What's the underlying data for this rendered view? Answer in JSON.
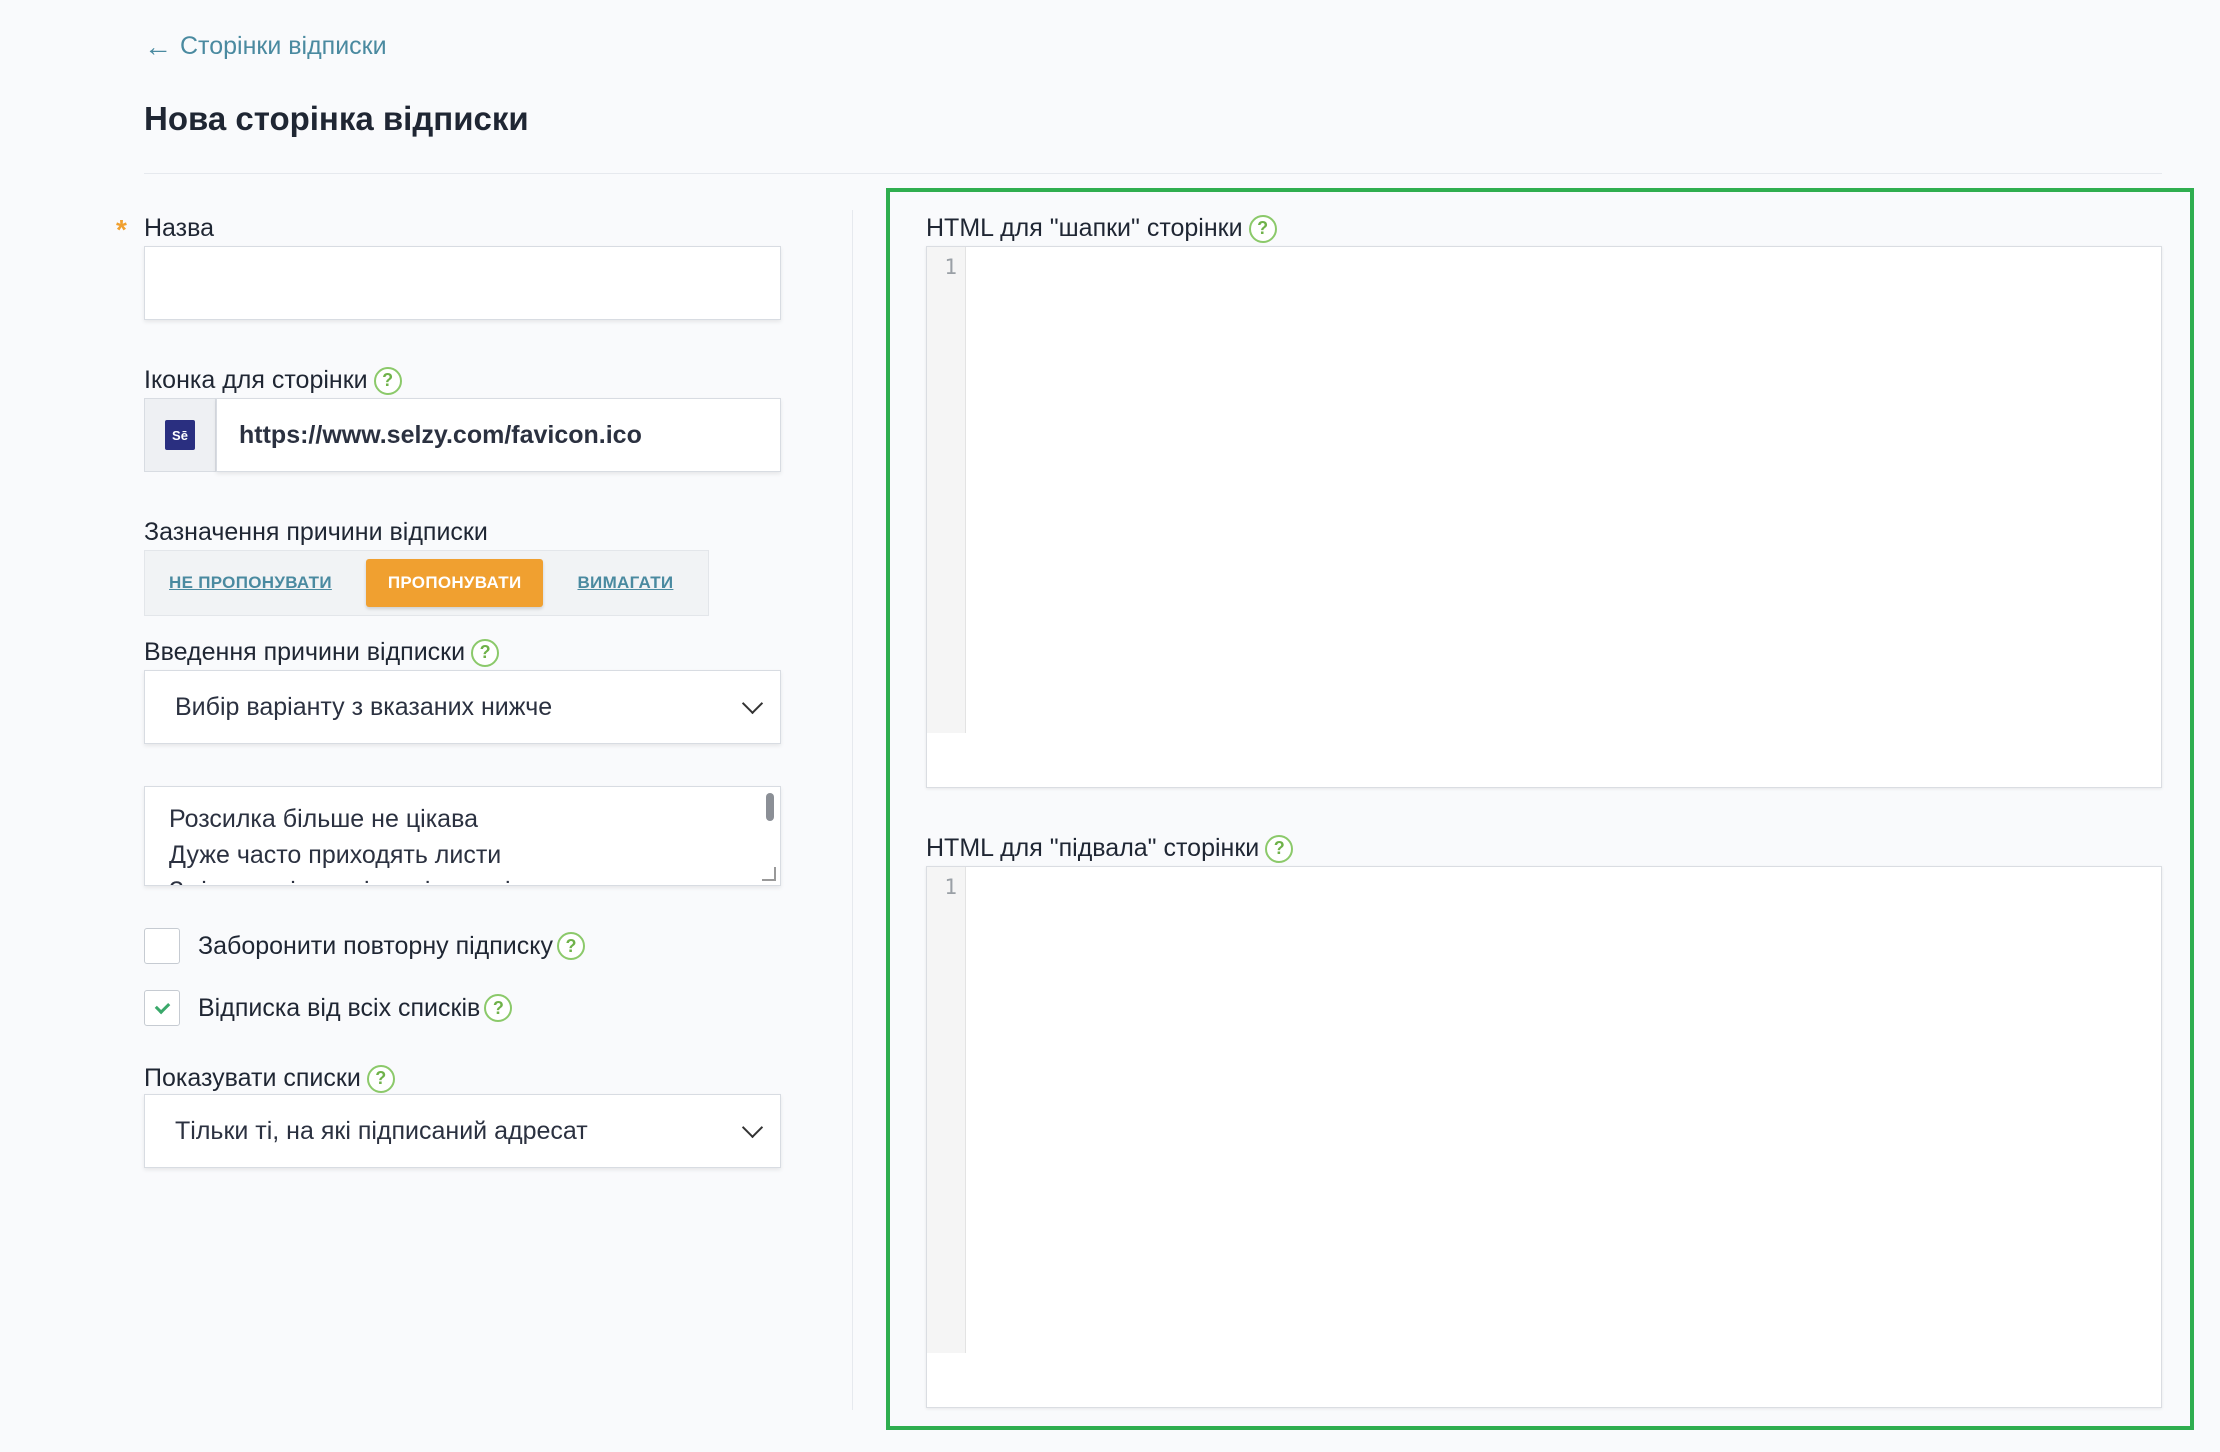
{
  "nav": {
    "back_arrow": "←",
    "back_label": "Сторінки відписки"
  },
  "page": {
    "title": "Нова сторінка відписки"
  },
  "form": {
    "name_label": "Назва",
    "required_mark": "*",
    "name_value": "",
    "icon_label": "Іконка для сторінки",
    "icon_text": "Sē",
    "icon_url": "https://www.selzy.com/favicon.ico",
    "reason_label": "Зазначення причини відписки",
    "reason_options": [
      "НЕ ПРОПОНУВАТИ",
      "ПРОПОНУВАТИ",
      "ВИМАГАТИ"
    ],
    "reason_selected": "ПРОПОНУВАТИ",
    "input_reason_label": "Введення причини відписки",
    "input_reason_value": "Вибір варіанту з вказаних нижче",
    "reasons_list": [
      "Розсилка більше не цікава",
      "Дуже часто приходять листи",
      "Зміст листів не відповідає очікуванням"
    ],
    "forbid_resubscribe_label": "Заборонити повторну підписку",
    "forbid_resubscribe_checked": false,
    "unsub_all_label": "Відписка від всіх списків",
    "unsub_all_checked": true,
    "show_lists_label": "Показувати списки",
    "show_lists_value": "Тільки ті, на які підписаний адресат",
    "help_glyph": "?"
  },
  "editors": {
    "header_label": "HTML для \"шапки\" сторінки",
    "footer_label": "HTML для \"підвала\" сторінки",
    "line_number": "1"
  },
  "colors": {
    "accent_orange": "#f0a030",
    "highlight_green": "#2fae4f",
    "link": "#4a8aa0"
  }
}
